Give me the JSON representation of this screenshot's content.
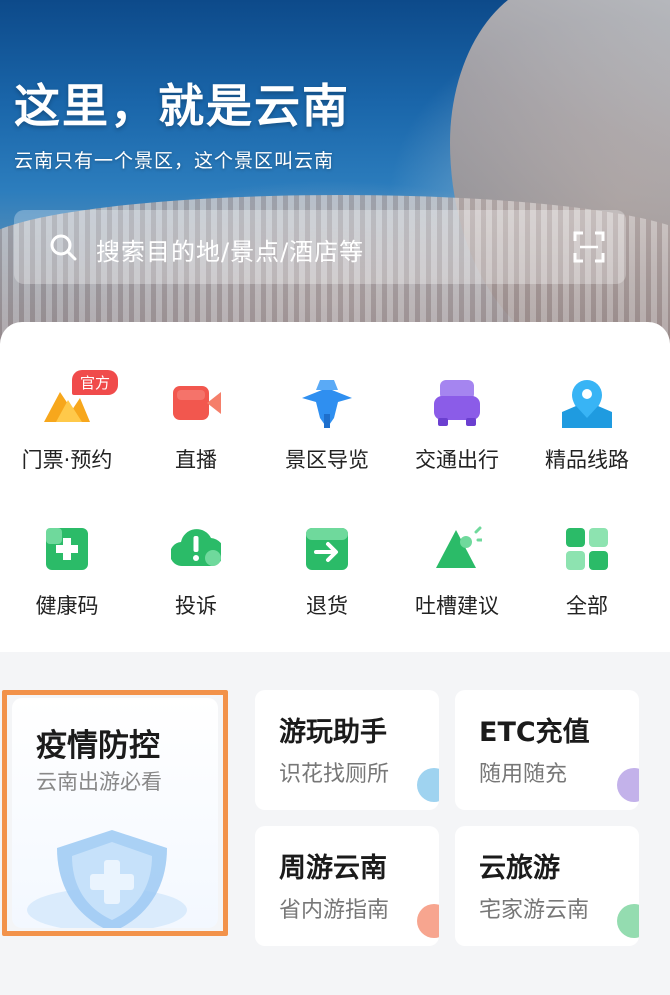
{
  "hero": {
    "title": "这里，就是云南",
    "subtitle": "云南只有一个景区，这个景区叫云南"
  },
  "search": {
    "placeholder": "搜索目的地/景点/酒店等",
    "search_icon": "search-icon",
    "scan_icon": "scan-icon"
  },
  "functions": {
    "badge": "官方",
    "items": [
      {
        "label": "门票·预约",
        "icon": "ticket-icon",
        "color": "#f7a71c"
      },
      {
        "label": "直播",
        "icon": "live-video-icon",
        "color": "#f2574e"
      },
      {
        "label": "景区导览",
        "icon": "guide-icon",
        "color": "#2f8ff0"
      },
      {
        "label": "交通出行",
        "icon": "car-icon",
        "color": "#8b5ce8"
      },
      {
        "label": "精品线路",
        "icon": "route-icon",
        "color": "#38b4f5"
      },
      {
        "label": "健康码",
        "icon": "health-code-icon",
        "color": "#2bbb68"
      },
      {
        "label": "投诉",
        "icon": "complaint-icon",
        "color": "#2bbb68"
      },
      {
        "label": "退货",
        "icon": "return-icon",
        "color": "#2bbb68"
      },
      {
        "label": "吐槽建议",
        "icon": "feedback-icon",
        "color": "#2bbb68"
      },
      {
        "label": "全部",
        "icon": "all-apps-icon",
        "color": "#2bbb68"
      }
    ]
  },
  "cards": {
    "epidemic": {
      "title": "疫情防控",
      "subtitle": "云南出游必看"
    },
    "assistant": {
      "title": "游玩助手",
      "subtitle": "识花找厕所",
      "color": "#9fd3f0"
    },
    "etc": {
      "title": "ETC充值",
      "subtitle": "随用随充",
      "color": "#c3b2ea"
    },
    "weekend": {
      "title": "周游云南",
      "subtitle": "省内游指南",
      "color": "#f7a58f"
    },
    "cloud": {
      "title": "云旅游",
      "subtitle": "宅家游云南",
      "color": "#94dcb0"
    }
  }
}
